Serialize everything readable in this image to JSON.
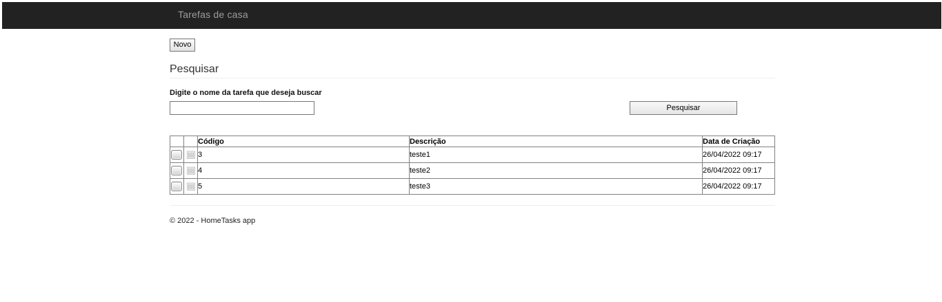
{
  "navbar": {
    "brand": "Tarefas de casa"
  },
  "toolbar": {
    "new_label": "Novo"
  },
  "search": {
    "title": "Pesquisar",
    "label": "Digite o nome da tarefa que deseja buscar",
    "value": "",
    "placeholder": "",
    "button_label": "Pesquisar"
  },
  "table": {
    "headers": {
      "code": "Código",
      "description": "Descrição",
      "created": "Data de Criação"
    },
    "rows": [
      {
        "code": "3",
        "description": "teste1",
        "created": "26/04/2022 09:17"
      },
      {
        "code": "4",
        "description": "teste2",
        "created": "26/04/2022 09:17"
      },
      {
        "code": "5",
        "description": "teste3",
        "created": "26/04/2022 09:17"
      }
    ],
    "edit_icon": "edit-icon",
    "delete_icon": "trash-icon"
  },
  "footer": {
    "text": "© 2022 - HomeTasks app"
  },
  "colors": {
    "navbar_bg": "#222222",
    "navbar_text": "#9d9d9d",
    "table_border": "#808080"
  }
}
